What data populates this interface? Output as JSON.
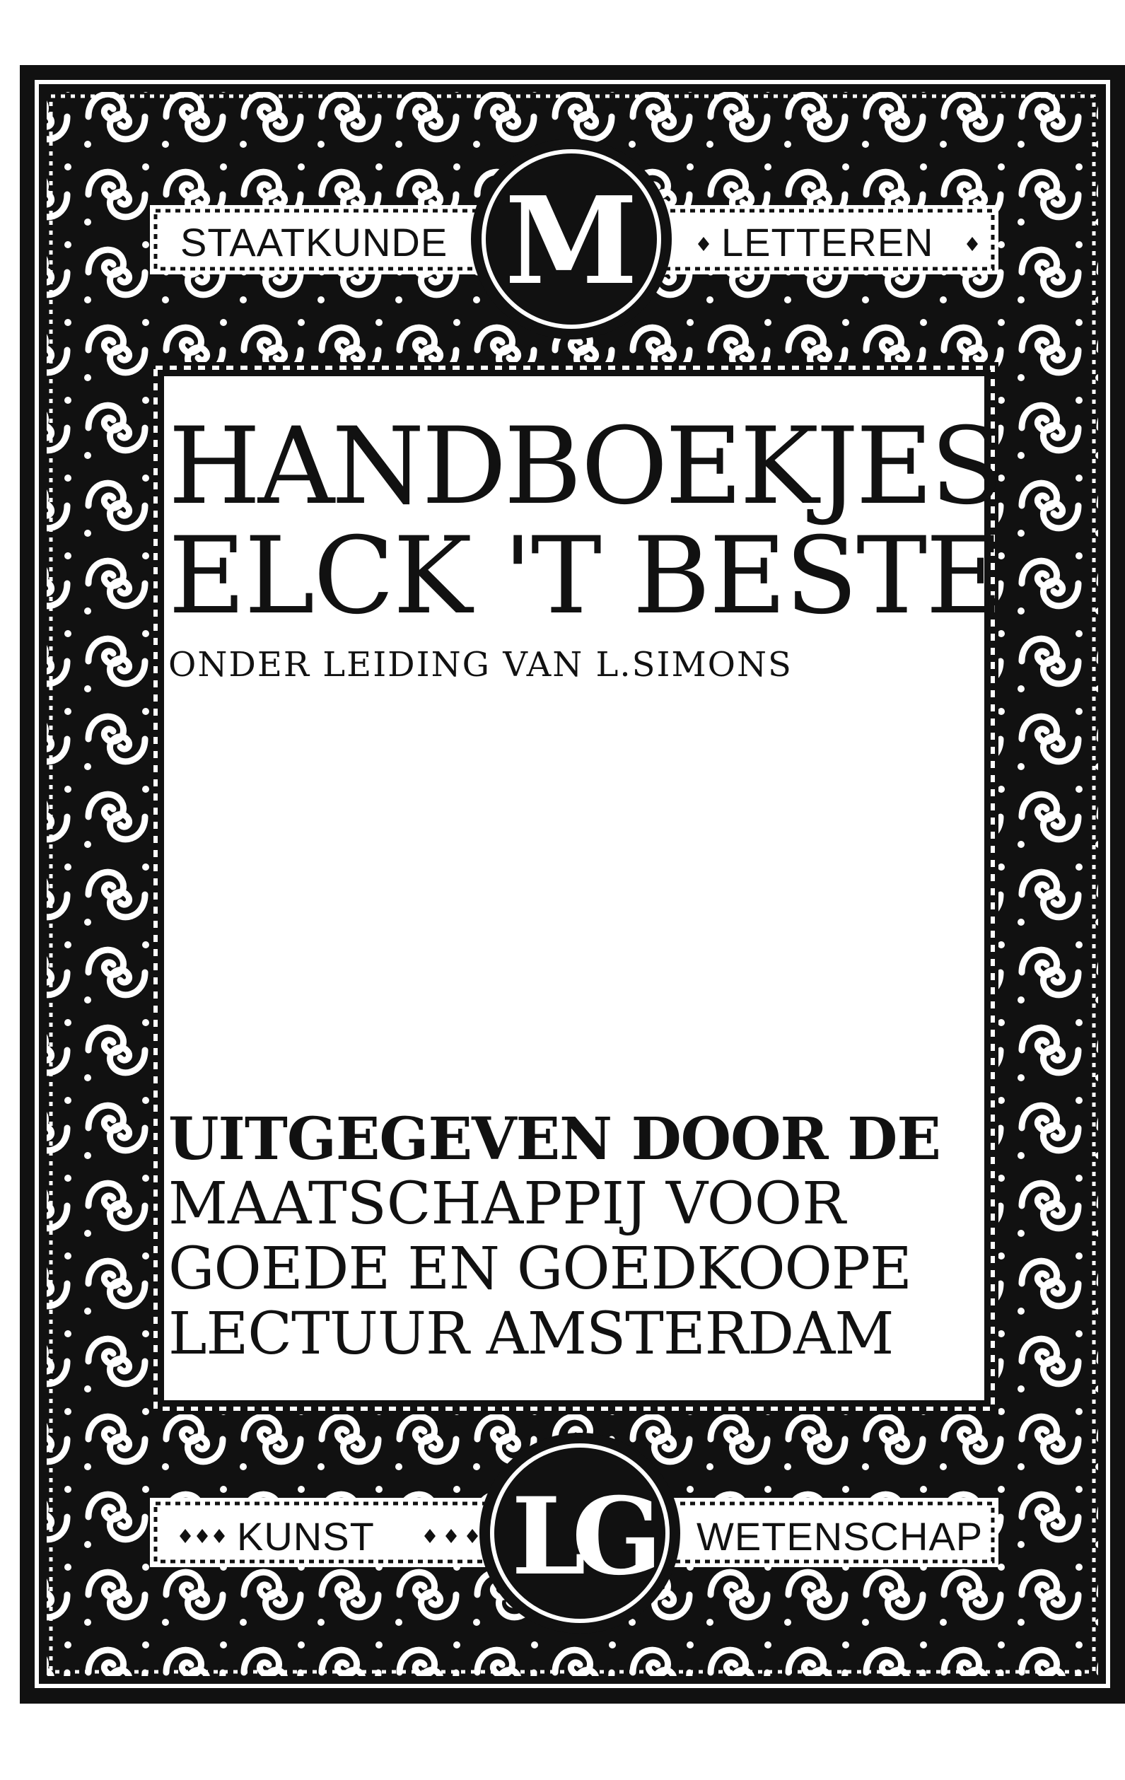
{
  "cover": {
    "top_band": {
      "left_label": "STAATKUNDE",
      "monogram": "M",
      "right_label": "LETTEREN"
    },
    "title": {
      "line_1": "HANDBOEKJES",
      "line_2": "ELCK 'T BESTE"
    },
    "editor": "ONDER LEIDING VAN L.SIMONS",
    "publisher": {
      "line_1": "UITGEGEVEN DOOR DE",
      "line_2": "MAATSCHAPPIJ VOOR",
      "line_3": "GOEDE EN GOEDKOOPE",
      "line_4": "LECTUUR AMSTERDAM"
    },
    "bottom_band": {
      "left_label": "KUNST",
      "monogram": "LG",
      "right_label": "WETENSCHAP"
    }
  },
  "colors": {
    "ink": "#111111",
    "paper": "#ffffff"
  }
}
